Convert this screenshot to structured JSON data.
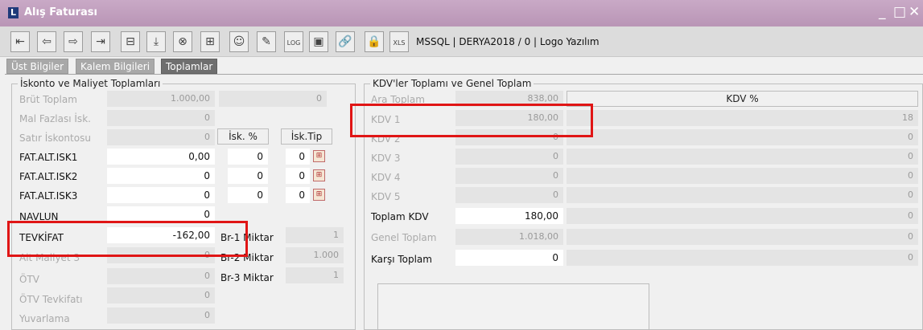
{
  "window": {
    "title": "Alış Faturası",
    "app_icon_letter": "L",
    "min": "_",
    "max": "□",
    "close": "✕"
  },
  "toolbar": {
    "icons": [
      "first-icon",
      "prev-icon",
      "next-icon",
      "last-icon",
      "minimize-icon",
      "download-icon",
      "cancel-icon",
      "add-icon",
      "user-icon",
      "edit-icon",
      "log-icon",
      "document-icon",
      "link-icon",
      "lock-icon",
      "xls-icon"
    ],
    "db_info": "MSSQL | DERYA2018 / 0 | Logo Yazılım"
  },
  "tabs": [
    {
      "label": "Üst Bilgiler",
      "active": false
    },
    {
      "label": "Kalem Bilgileri",
      "active": false
    },
    {
      "label": "Toplamlar",
      "active": true
    }
  ],
  "left_group": {
    "title": "İskonto ve Maliyet Toplamları",
    "brut": {
      "label": "Brüt Toplam",
      "value": "1.000,00",
      "value2": "0"
    },
    "mal_fazlasi": {
      "label": "Mal Fazlası İsk.",
      "value": "0"
    },
    "satir_iskonto": {
      "label": "Satır İskontosu",
      "value": "0",
      "isk_pct_header": "İsk. %",
      "isk_tip_header": "İsk.Tip"
    },
    "fat_alt": [
      {
        "label": "FAT.ALT.ISK1",
        "value": "0,00",
        "pct": "0",
        "tip": "0"
      },
      {
        "label": "FAT.ALT.ISK2",
        "value": "0",
        "pct": "0",
        "tip": "0"
      },
      {
        "label": "FAT.ALT.ISK3",
        "value": "0",
        "pct": "0",
        "tip": "0"
      }
    ],
    "navlun": {
      "label": "NAVLUN",
      "value": "0"
    },
    "tevkifat": {
      "label": "TEVKİFAT",
      "value": "-162,00"
    },
    "alt_maliyet3": {
      "label": "Alt Maliyet 3",
      "value": "0"
    },
    "otv": {
      "label": "ÖTV",
      "value": "0"
    },
    "otv_tevkifat": {
      "label": "ÖTV Tevkifatı",
      "value": "0"
    },
    "yuvarlama": {
      "label": "Yuvarlama",
      "value": "0"
    },
    "miktar": [
      {
        "label": "Br-1 Miktar",
        "value": "1"
      },
      {
        "label": "Br-2 Miktar",
        "value": "1.000"
      },
      {
        "label": "Br-3 Miktar",
        "value": "1"
      }
    ]
  },
  "right_group": {
    "title": "KDV'ler Toplamı ve Genel Toplam",
    "ara_toplam": {
      "label": "Ara Toplam",
      "value": "838,00"
    },
    "kdv_pct_header": "KDV %",
    "kdv_rows": [
      {
        "label": "KDV 1",
        "value": "180,00",
        "pct": "18"
      },
      {
        "label": "KDV 2",
        "value": "0",
        "pct": "0"
      },
      {
        "label": "KDV 3",
        "value": "0",
        "pct": "0"
      },
      {
        "label": "KDV 4",
        "value": "0",
        "pct": "0"
      },
      {
        "label": "KDV 5",
        "value": "0",
        "pct": "0"
      }
    ],
    "toplam_kdv": {
      "label": "Toplam KDV",
      "value": "180,00",
      "pct": "0"
    },
    "genel_toplam": {
      "label": "Genel Toplam",
      "value": "1.018,00",
      "pct": "0"
    },
    "karsi_toplam": {
      "label": "Karşı Toplam",
      "value": "0",
      "pct": "0"
    }
  },
  "highlight_color": "#e01515"
}
